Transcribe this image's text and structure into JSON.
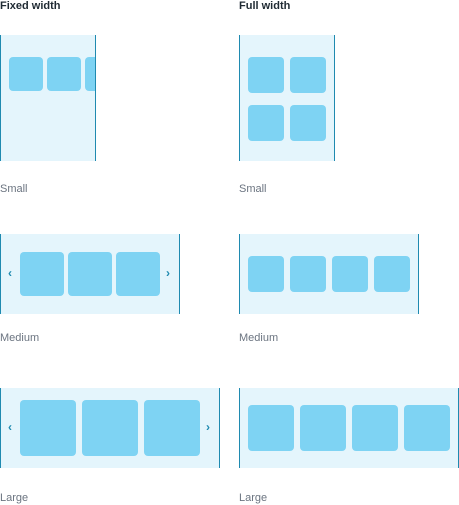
{
  "columns": {
    "fixed": {
      "title": "Fixed width"
    },
    "full": {
      "title": "Full width"
    }
  },
  "sizes": {
    "small": "Small",
    "medium": "Medium",
    "large": "Large"
  },
  "arrows": {
    "prev": "‹",
    "next": "›"
  },
  "colors": {
    "panel_bg": "#e4f5fc",
    "tile": "#7ed3f3",
    "edge": "#1f8ab0",
    "heading": "#1f2a33",
    "caption": "#6b7480"
  }
}
